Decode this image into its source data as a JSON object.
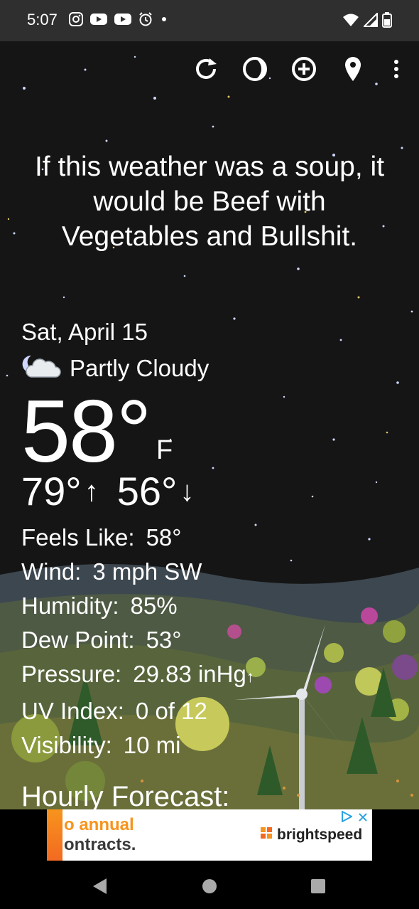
{
  "status_bar": {
    "time": "5:07",
    "notification_icons": [
      "instagram-icon",
      "youtube-icon",
      "youtube-icon",
      "alarm-icon",
      "dot-icon"
    ],
    "system_icons": [
      "wifi-icon",
      "signal-icon",
      "battery-icon"
    ]
  },
  "toolbar": {
    "actions": [
      "refresh-icon",
      "moon-phase-icon",
      "add-location-icon",
      "location-pin-icon",
      "more-options-icon"
    ]
  },
  "quote": "If this weather was a soup, it would be Beef with Vegetables and Bullshit.",
  "current": {
    "date": "Sat, April 15",
    "condition": "Partly Cloudy",
    "condition_icon": "partly-cloudy-night-icon",
    "temperature": "58°",
    "unit": "F",
    "high": "79°",
    "low": "56°"
  },
  "details": [
    {
      "label": "Feels Like:",
      "value": "58°"
    },
    {
      "label": "Wind:",
      "value": "3 mph SW"
    },
    {
      "label": "Humidity:",
      "value": "85%"
    },
    {
      "label": "Dew Point:",
      "value": "53°"
    },
    {
      "label": "Pressure:",
      "value": "29.83 inHg",
      "trend": "↑"
    },
    {
      "label": "UV Index:",
      "value": "0 of 12"
    },
    {
      "label": "Visibility:",
      "value": "10 mi"
    }
  ],
  "hourly_heading": "Hourly Forecast:",
  "ad": {
    "line1": "o annual",
    "line2": "ontracts.",
    "brand": "brightspeed",
    "brand_color": "#f7941d"
  },
  "colors": {
    "status_bar": "#2f2f2f",
    "sky": "#141414",
    "ad_accent": "#f7941d",
    "ad_choice": "#2aa3e0"
  }
}
